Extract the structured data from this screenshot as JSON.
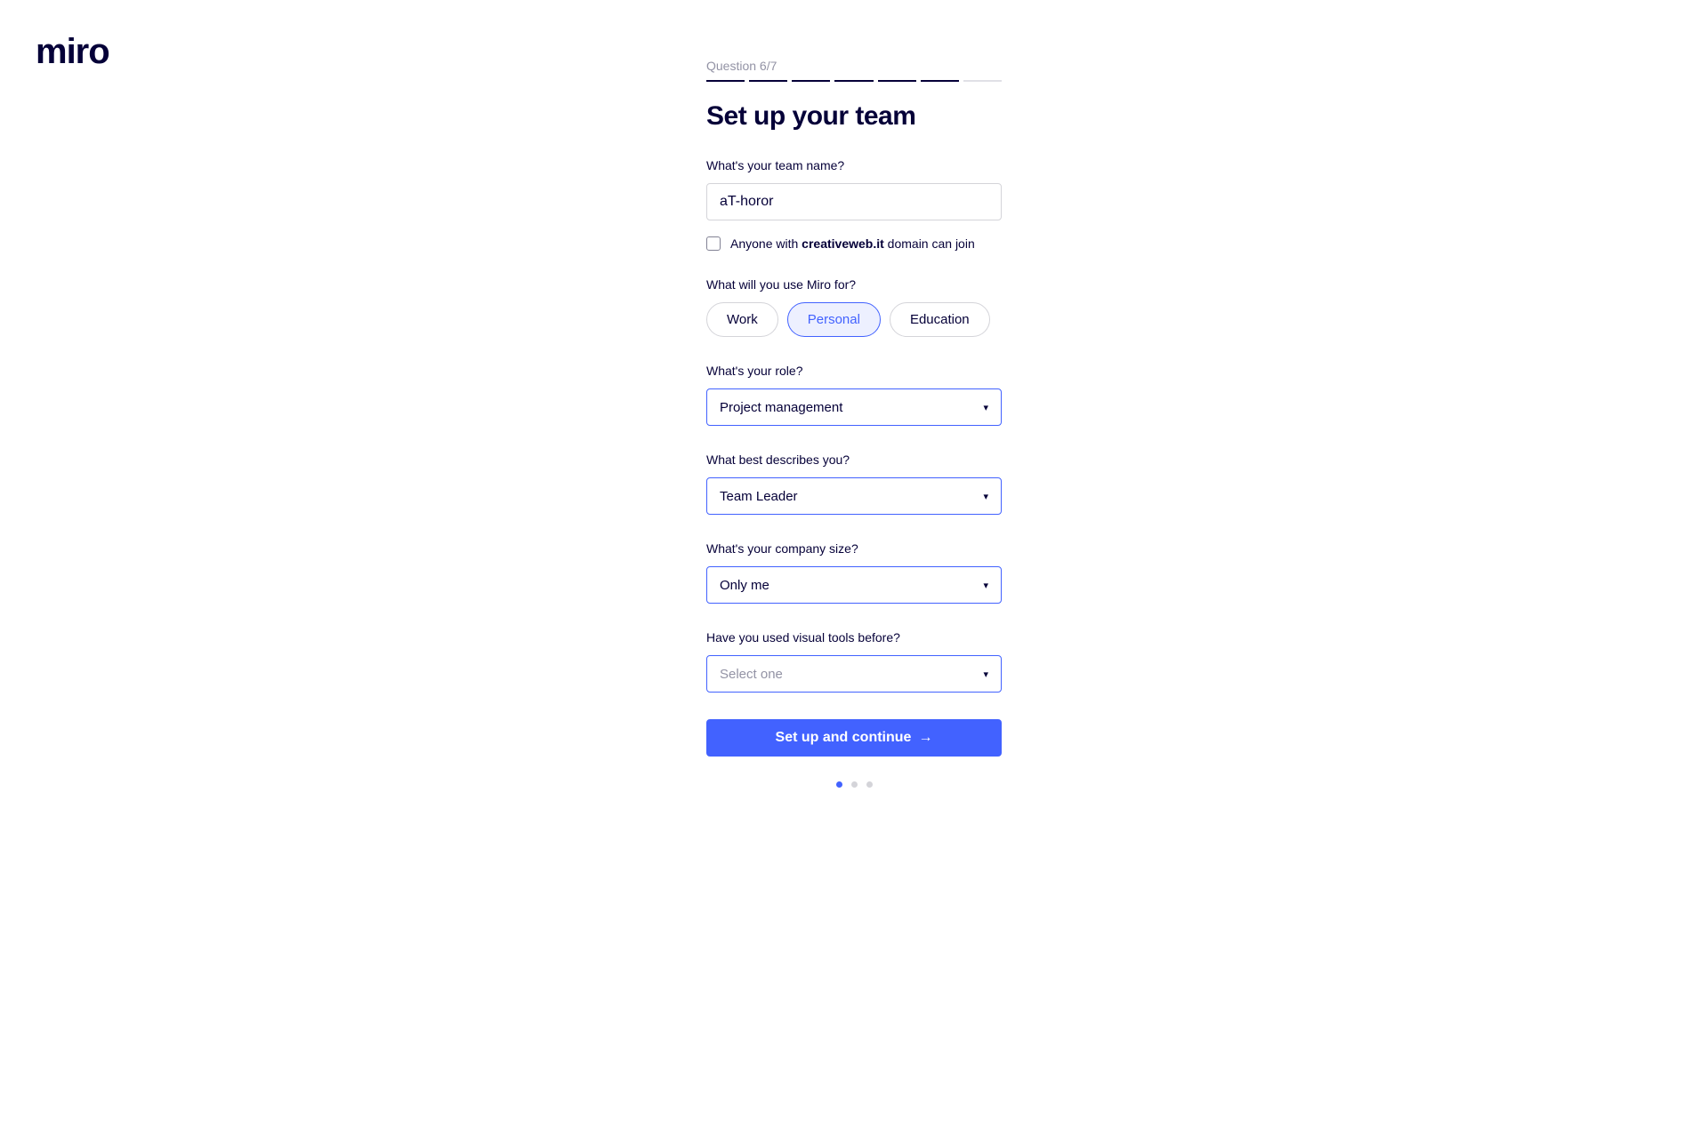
{
  "logo": "miro",
  "progress": {
    "label": "Question 6/7",
    "total": 7,
    "done": 6
  },
  "title": "Set up your team",
  "fields": {
    "teamName": {
      "label": "What's your team name?",
      "value": "aT-horor"
    },
    "domainJoin": {
      "prefix": "Anyone with ",
      "domain": "creativeweb.it",
      "suffix": " domain can join",
      "checked": false
    },
    "useFor": {
      "label": "What will you use Miro for?",
      "options": [
        {
          "label": "Work",
          "active": false
        },
        {
          "label": "Personal",
          "active": true
        },
        {
          "label": "Education",
          "active": false
        }
      ]
    },
    "role": {
      "label": "What's your role?",
      "value": "Project management"
    },
    "describes": {
      "label": "What best describes you?",
      "value": "Team Leader"
    },
    "companySize": {
      "label": "What's your company size?",
      "value": "Only me"
    },
    "visualTools": {
      "label": "Have you used visual tools before?",
      "placeholder": "Select one"
    }
  },
  "submitLabel": "Set up and continue",
  "pager": {
    "total": 3,
    "active": 0
  }
}
